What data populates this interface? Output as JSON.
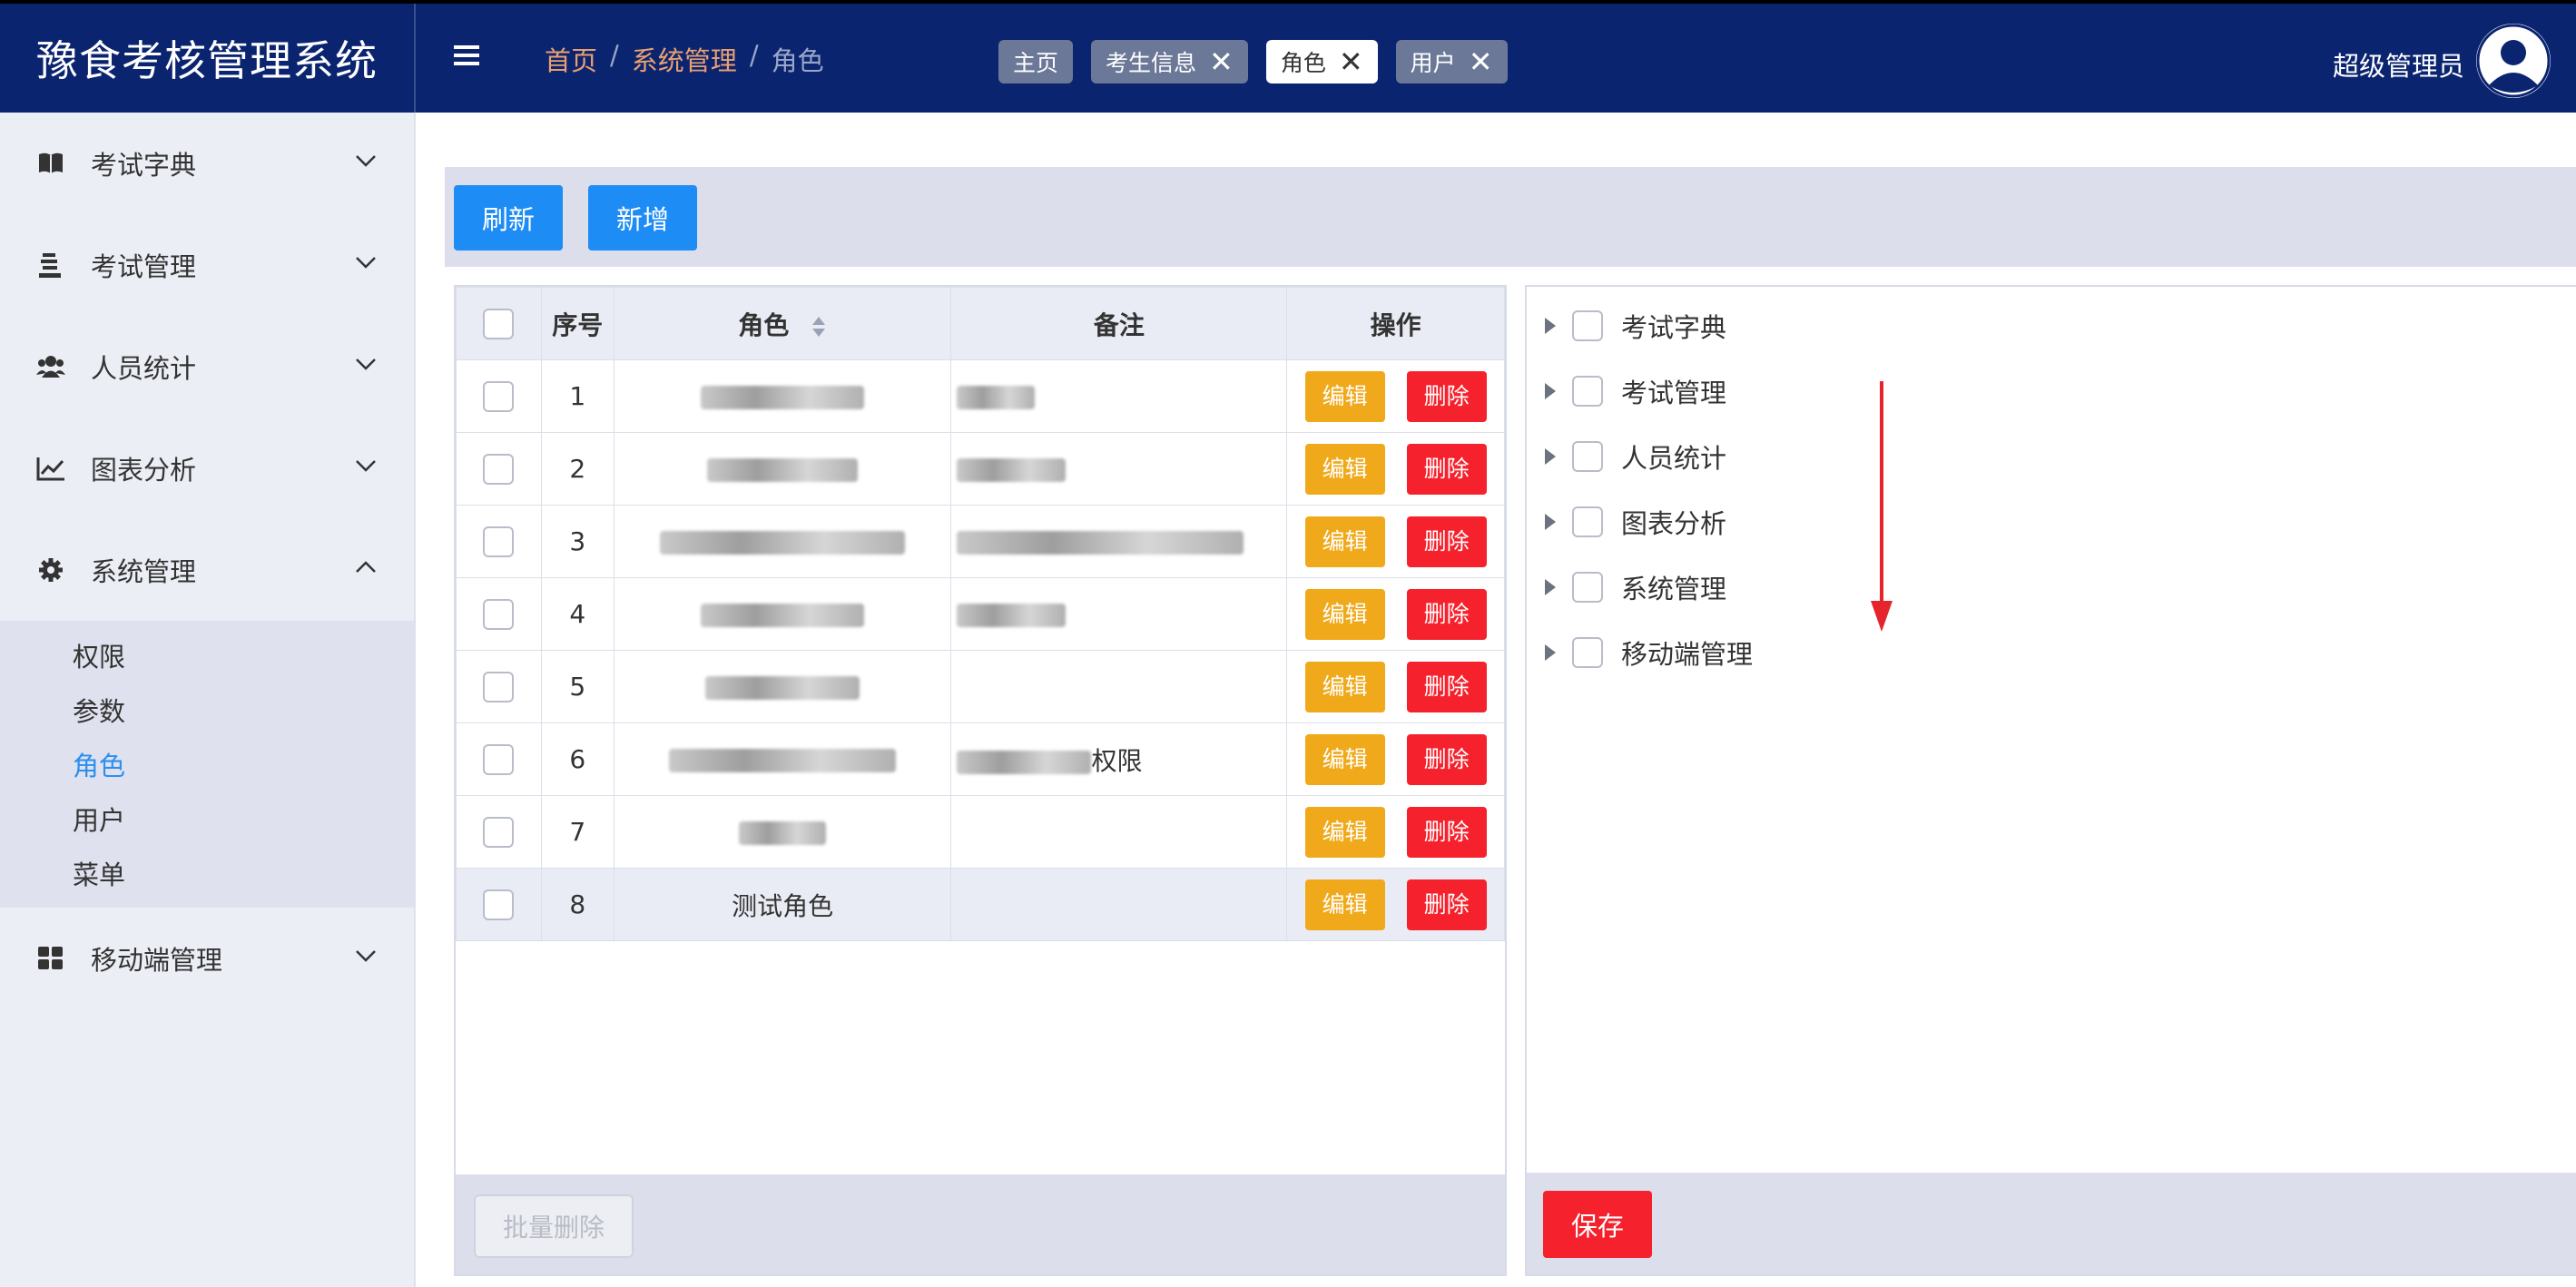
{
  "app": {
    "title": "豫食考核管理系统"
  },
  "breadcrumb": {
    "home": "首页",
    "sep1": "/",
    "section": "系统管理",
    "sep2": "/",
    "current": "角色"
  },
  "tabs": [
    {
      "label": "主页",
      "closable": false,
      "active": false
    },
    {
      "label": "考生信息",
      "closable": true,
      "active": false,
      "close": "✕"
    },
    {
      "label": "角色",
      "closable": true,
      "active": true,
      "close": "✕"
    },
    {
      "label": "用户",
      "closable": true,
      "active": false,
      "close": "✕"
    }
  ],
  "user": {
    "name": "超级管理员"
  },
  "sidebar": {
    "items": [
      {
        "label": "考试字典",
        "icon": "book-icon",
        "expanded": false
      },
      {
        "label": "考试管理",
        "icon": "exam-icon",
        "expanded": false
      },
      {
        "label": "人员统计",
        "icon": "users-icon",
        "expanded": false
      },
      {
        "label": "图表分析",
        "icon": "chart-icon",
        "expanded": false
      },
      {
        "label": "系统管理",
        "icon": "gear-icon",
        "expanded": true
      },
      {
        "label": "移动端管理",
        "icon": "grid-icon",
        "expanded": false
      }
    ],
    "sub_items": [
      {
        "label": "权限",
        "active": false
      },
      {
        "label": "参数",
        "active": false
      },
      {
        "label": "角色",
        "active": true
      },
      {
        "label": "用户",
        "active": false
      },
      {
        "label": "菜单",
        "active": false
      }
    ]
  },
  "toolbar": {
    "refresh_label": "刷新",
    "add_label": "新增"
  },
  "table": {
    "headers": {
      "index": "序号",
      "role": "角色",
      "remark": "备注",
      "actions": "操作"
    },
    "edit_label": "编辑",
    "delete_label": "删除",
    "rows": [
      {
        "index": "1",
        "role": "ROLE_ADMIN",
        "remark": "管理员",
        "blurred": true
      },
      {
        "index": "2",
        "role": "ROLE_USER",
        "remark": "普通用户",
        "blurred": true
      },
      {
        "index": "3",
        "role": "ROLE_MOBILE_USER",
        "remark": "移动端用户角色",
        "blurred": true
      },
      {
        "index": "4",
        "role": "ROLE_TEST",
        "remark": "测试角色",
        "blurred": true
      },
      {
        "index": "5",
        "role": "ROLE_VIEW",
        "remark": "",
        "blurred": true
      },
      {
        "index": "6",
        "role": "ROLE_MOBILE_ADMIN",
        "remark": "移动端管理权限",
        "blurred": true
      },
      {
        "index": "7",
        "role": "测试角色",
        "remark": "",
        "blurred": true
      },
      {
        "index": "8",
        "role": "测试角色",
        "remark": "",
        "blurred": false
      }
    ],
    "visible_fragments": {
      "row6_remark_tail": "权限"
    },
    "batch_delete_label": "批量删除"
  },
  "tree": {
    "nodes": [
      "考试字典",
      "考试管理",
      "人员统计",
      "图表分析",
      "系统管理",
      "移动端管理"
    ],
    "save_label": "保存"
  },
  "colors": {
    "header": "#0b2470",
    "primary": "#1e8cf5",
    "warning": "#f0a91a",
    "danger": "#f5222d",
    "annotation_arrow": "#e5242b"
  }
}
